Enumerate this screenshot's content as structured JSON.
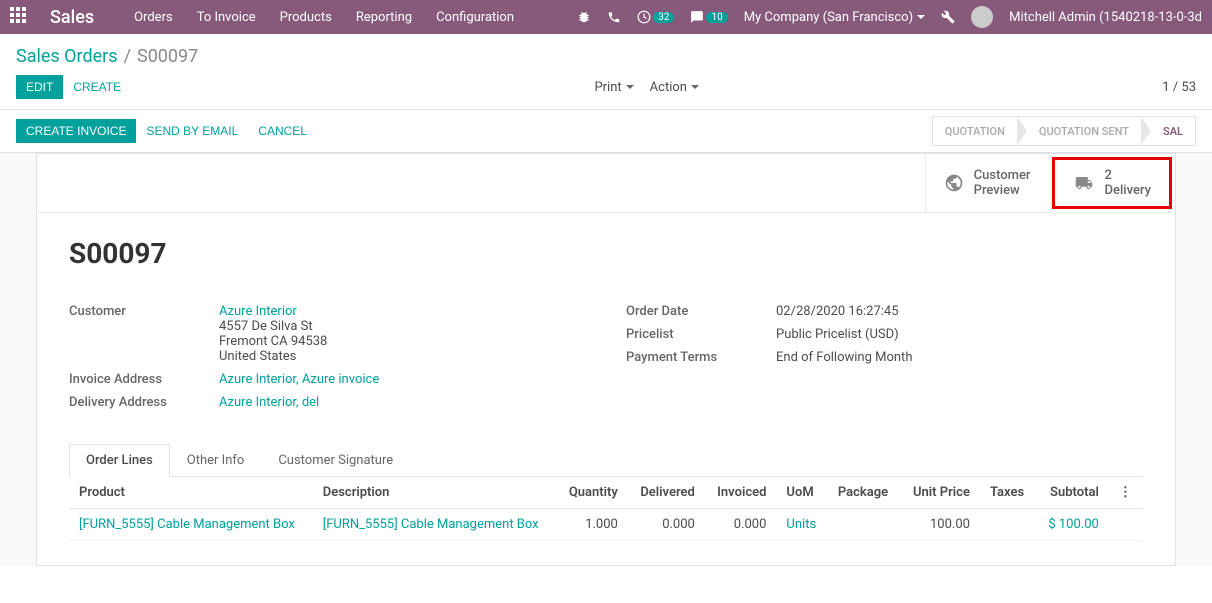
{
  "topbar": {
    "brand": "Sales",
    "menu": [
      "Orders",
      "To Invoice",
      "Products",
      "Reporting",
      "Configuration"
    ],
    "activities_count": "32",
    "messages_count": "10",
    "company": "My Company (San Francisco)",
    "user": "Mitchell Admin (1540218-13-0-3d"
  },
  "breadcrumb": {
    "parent": "Sales Orders",
    "current": "S00097"
  },
  "toolbar": {
    "edit": "Edit",
    "create": "Create",
    "print": "Print",
    "action": "Action",
    "pager": "1 / 53"
  },
  "actions": {
    "create_invoice": "Create Invoice",
    "send_email": "Send by Email",
    "cancel": "Cancel"
  },
  "status": {
    "quotation": "Quotation",
    "quotation_sent": "Quotation Sent",
    "sales_order": "Sal"
  },
  "stat_buttons": {
    "preview": "Customer\nPreview",
    "delivery_count": "2",
    "delivery_label": "Delivery"
  },
  "record": {
    "title": "S00097",
    "customer_label": "Customer",
    "customer_name": "Azure Interior",
    "customer_addr_1": "4557 De Silva St",
    "customer_addr_2": "Fremont CA 94538",
    "customer_addr_3": "United States",
    "invoice_addr_label": "Invoice Address",
    "invoice_addr": "Azure Interior, Azure invoice",
    "delivery_addr_label": "Delivery Address",
    "delivery_addr": "Azure Interior, del",
    "order_date_label": "Order Date",
    "order_date": "02/28/2020 16:27:45",
    "pricelist_label": "Pricelist",
    "pricelist": "Public Pricelist (USD)",
    "payment_terms_label": "Payment Terms",
    "payment_terms": "End of Following Month"
  },
  "tabs": {
    "order_lines": "Order Lines",
    "other_info": "Other Info",
    "customer_signature": "Customer Signature"
  },
  "lines": {
    "headers": {
      "product": "Product",
      "description": "Description",
      "quantity": "Quantity",
      "delivered": "Delivered",
      "invoiced": "Invoiced",
      "uom": "UoM",
      "package": "Package",
      "unit_price": "Unit Price",
      "taxes": "Taxes",
      "subtotal": "Subtotal"
    },
    "row1": {
      "product": "[FURN_5555] Cable Management Box",
      "description": "[FURN_5555] Cable Management Box",
      "quantity": "1.000",
      "delivered": "0.000",
      "invoiced": "0.000",
      "uom": "Units",
      "package": "",
      "unit_price": "100.00",
      "taxes": "",
      "subtotal": "$ 100.00"
    }
  }
}
